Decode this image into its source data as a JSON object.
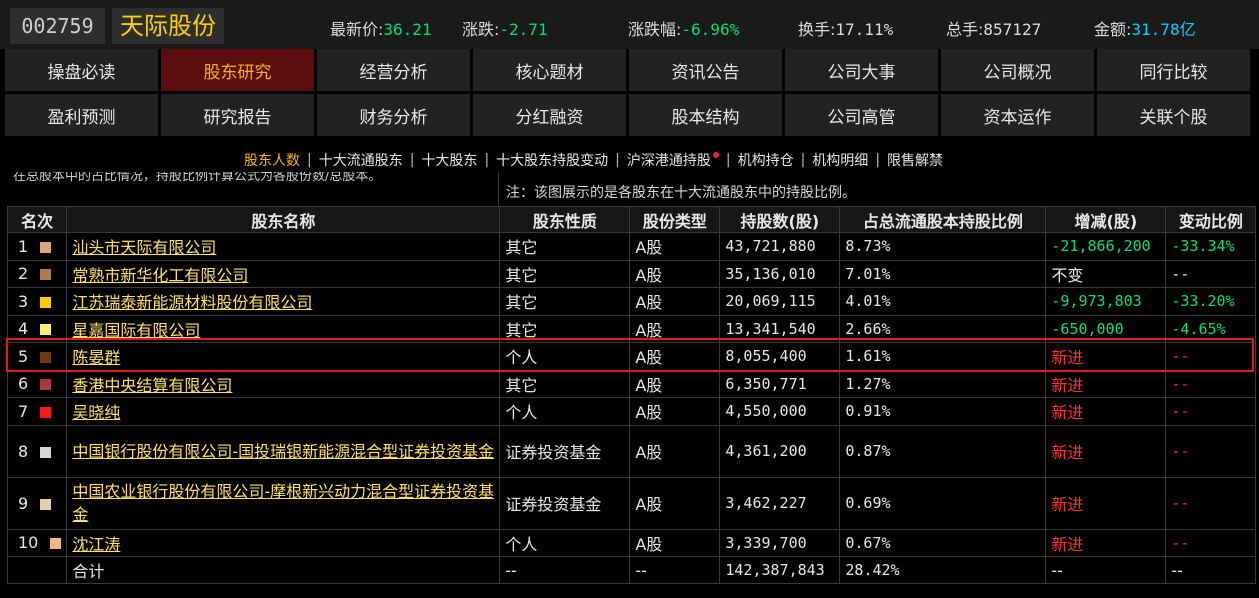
{
  "header": {
    "code": "002759",
    "name": "天际股份",
    "quotes": [
      {
        "label": "最新价:",
        "value": "36.21",
        "color": "green"
      },
      {
        "label": "涨跌:",
        "value": "-2.71",
        "color": "green"
      },
      {
        "label": "涨跌幅:",
        "value": "-6.96%",
        "color": "green"
      },
      {
        "label": "换手:",
        "value": "17.11%",
        "color": "plain"
      },
      {
        "label": "总手:",
        "value": "857127",
        "color": "plain"
      },
      {
        "label": "金额:",
        "value": "31.78亿",
        "color": "cyan"
      }
    ]
  },
  "nav": {
    "row1": [
      "操盘必读",
      "股东研究",
      "经营分析",
      "核心题材",
      "资讯公告",
      "公司大事",
      "公司概况",
      "同行比较"
    ],
    "row2": [
      "盈利预测",
      "研究报告",
      "财务分析",
      "分红融资",
      "股本结构",
      "公司高管",
      "资本运作",
      "关联个股"
    ],
    "active": "股东研究"
  },
  "subnav": {
    "items": [
      "股东人数",
      "十大流通股东",
      "十大股东",
      "十大股东持股变动",
      "沪深港通持股",
      "机构持仓",
      "机构明细",
      "限售解禁"
    ],
    "active": "股东人数"
  },
  "notes": {
    "left": "在总股本中的占比情况，持股比例计算公式为各股份数/总股本。",
    "right": "注：该图展示的是各股东在十大流通股东中的持股比例。"
  },
  "table": {
    "headers": [
      "名次",
      "股东名称",
      "股东性质",
      "股份类型",
      "持股数(股)",
      "占总流通股本持股比例",
      "增减(股)",
      "变动比例"
    ],
    "rows": [
      {
        "rank": "1",
        "swatch": "#d9a878",
        "name": "汕头市天际有限公司",
        "nature": "其它",
        "type": "A股",
        "shares": "43,721,880",
        "ratio": "8.73%",
        "change": "-21,866,200",
        "pct": "-33.34%",
        "change_color": "green",
        "pct_color": "green"
      },
      {
        "rank": "2",
        "swatch": "#b07c48",
        "name": "常熟市新华化工有限公司",
        "nature": "其它",
        "type": "A股",
        "shares": "35,136,010",
        "ratio": "7.01%",
        "change": "不变",
        "pct": "--",
        "change_color": "plain",
        "pct_color": "plain"
      },
      {
        "rank": "3",
        "swatch": "#ffcc00",
        "name": "江苏瑞泰新能源材料股份有限公司",
        "nature": "其它",
        "type": "A股",
        "shares": "20,069,115",
        "ratio": "4.01%",
        "change": "-9,973,803",
        "pct": "-33.20%",
        "change_color": "green",
        "pct_color": "green"
      },
      {
        "rank": "4",
        "swatch": "#ffee77",
        "name": "星嘉国际有限公司",
        "nature": "其它",
        "type": "A股",
        "shares": "13,341,540",
        "ratio": "2.66%",
        "change": "-650,000",
        "pct": "-4.65%",
        "change_color": "green",
        "pct_color": "green"
      },
      {
        "rank": "5",
        "swatch": "#6b3a10",
        "name": "陈晏群",
        "nature": "个人",
        "type": "A股",
        "shares": "8,055,400",
        "ratio": "1.61%",
        "change": "新进",
        "pct": "--",
        "change_color": "red",
        "pct_color": "red"
      },
      {
        "rank": "6",
        "swatch": "#a83a3a",
        "name": "香港中央结算有限公司",
        "nature": "其它",
        "type": "A股",
        "shares": "6,350,771",
        "ratio": "1.27%",
        "change": "新进",
        "pct": "--",
        "change_color": "red",
        "pct_color": "red"
      },
      {
        "rank": "7",
        "swatch": "#ff1a1a",
        "name": "吴晓纯",
        "nature": "个人",
        "type": "A股",
        "shares": "4,550,000",
        "ratio": "0.91%",
        "change": "新进",
        "pct": "--",
        "change_color": "red",
        "pct_color": "red"
      },
      {
        "rank": "8",
        "swatch": "#d8d8d8",
        "name": "中国银行股份有限公司-国投瑞银新能源混合型证券投资基金",
        "nature": "证券投资基金",
        "type": "A股",
        "shares": "4,361,200",
        "ratio": "0.87%",
        "change": "新进",
        "pct": "--",
        "change_color": "red",
        "pct_color": "red"
      },
      {
        "rank": "9",
        "swatch": "#e0cdb4",
        "name": "中国农业银行股份有限公司-摩根新兴动力混合型证券投资基金",
        "nature": "证券投资基金",
        "type": "A股",
        "shares": "3,462,227",
        "ratio": "0.69%",
        "change": "新进",
        "pct": "--",
        "change_color": "red",
        "pct_color": "red"
      },
      {
        "rank": "10",
        "swatch": "#f2b48a",
        "name": "沈江涛",
        "nature": "个人",
        "type": "A股",
        "shares": "3,339,700",
        "ratio": "0.67%",
        "change": "新进",
        "pct": "--",
        "change_color": "red",
        "pct_color": "red"
      }
    ],
    "total": {
      "label": "合计",
      "nature": "--",
      "type": "--",
      "shares": "142,387,843",
      "ratio": "28.42%",
      "change": "--",
      "pct": "--"
    }
  }
}
